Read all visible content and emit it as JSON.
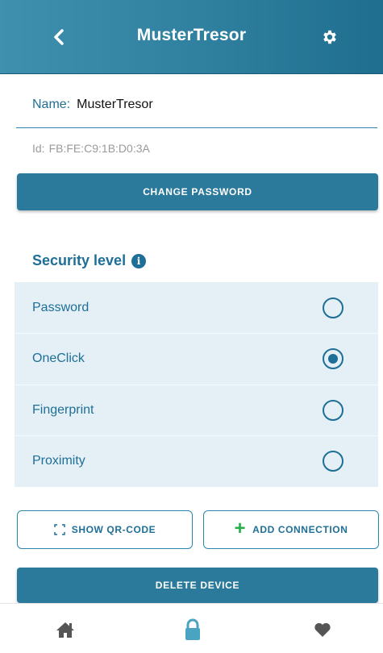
{
  "header": {
    "title": "MusterTresor",
    "back_icon": "chevron-left-icon",
    "settings_icon": "gear-icon"
  },
  "device": {
    "name_label": "Name:",
    "name_value": "MusterTresor",
    "id_label": "Id:",
    "id_value": "FB:FE:C9:1B:D0:3A"
  },
  "actions": {
    "change_password": "CHANGE PASSWORD",
    "show_qr": "SHOW QR-CODE",
    "add_connection": "ADD CONNECTION",
    "delete_device": "DELETE DEVICE"
  },
  "security": {
    "title": "Security level",
    "options": [
      {
        "label": "Password",
        "selected": false
      },
      {
        "label": "OneClick",
        "selected": true
      },
      {
        "label": "Fingerprint",
        "selected": false
      },
      {
        "label": "Proximity",
        "selected": false
      }
    ]
  },
  "nav": {
    "items": [
      {
        "icon": "home-icon",
        "active": false
      },
      {
        "icon": "lock-icon",
        "active": true
      },
      {
        "icon": "heart-icon",
        "active": false
      }
    ]
  },
  "colors": {
    "primary": "#2b7a9b",
    "accent_text": "#1e6f97",
    "options_bg": "#e4f0f5",
    "plus": "#2ab04a",
    "nav_active": "#4aa3c0",
    "nav_inactive": "#555555"
  }
}
